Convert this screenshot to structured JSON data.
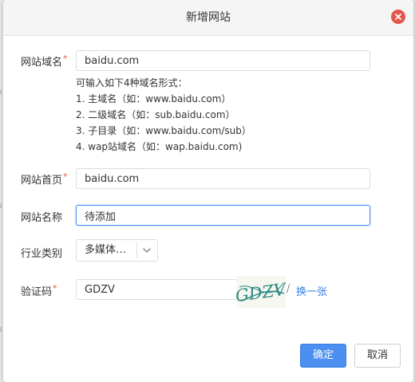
{
  "dialog": {
    "title": "新增网站",
    "close_icon": "close-icon",
    "accent_color": "#4b8ff0",
    "close_color": "#e2574c"
  },
  "form": {
    "domain": {
      "label": "网站域名",
      "required_mark": "*",
      "value": "baidu.com"
    },
    "domain_hints": [
      "可输入如下4种域名形式：",
      "1. 主域名（如：www.baidu.com）",
      "2. 二级域名（如：sub.baidu.com）",
      "3. 子目录（如：www.baidu.com/sub）",
      "4. wap站域名（如：wap.baidu.com)"
    ],
    "homepage": {
      "label": "网站首页",
      "required_mark": "*",
      "value": "baidu.com"
    },
    "site_name": {
      "label": "网站名称",
      "value": "待添加"
    },
    "industry": {
      "label": "行业类别",
      "selected": "多媒体…",
      "arrow_icon": "chevron-down-icon"
    },
    "captcha": {
      "label": "验证码",
      "required_mark": "*",
      "value": "GDZV",
      "image_text": "GDZV",
      "separator": "/",
      "refresh_label": "换一张"
    }
  },
  "buttons": {
    "confirm_label": "确定",
    "cancel_label": "取消"
  }
}
